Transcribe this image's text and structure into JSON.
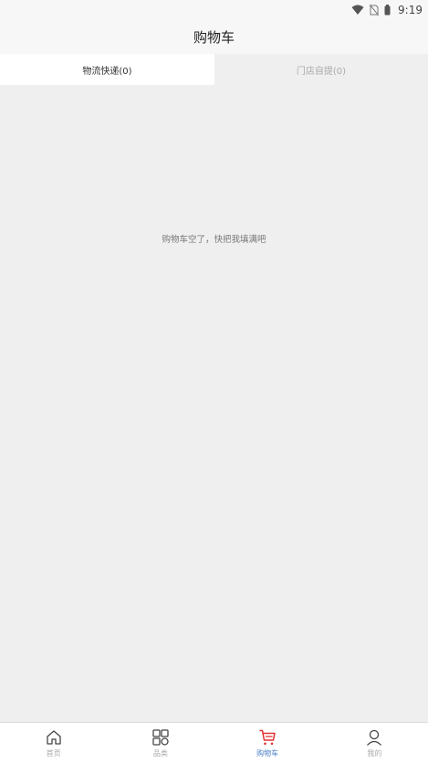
{
  "status_bar": {
    "time": "9:19",
    "icons": [
      "wifi-icon",
      "no-sim-icon",
      "battery-icon"
    ]
  },
  "header": {
    "title": "购物车"
  },
  "tabs": [
    {
      "label": "物流快递(0)",
      "active": true
    },
    {
      "label": "门店自提(0)",
      "active": false
    }
  ],
  "main": {
    "empty_message": "购物车空了，快把我填满吧"
  },
  "bottom_nav": {
    "items": [
      {
        "label": "首页",
        "icon": "home-icon",
        "active": false
      },
      {
        "label": "品类",
        "icon": "category-grid-icon",
        "active": false
      },
      {
        "label": "购物车",
        "icon": "cart-icon",
        "active": true
      },
      {
        "label": "我的",
        "icon": "user-icon",
        "active": false
      }
    ]
  },
  "colors": {
    "accent": "#e03131",
    "active_label": "#4a7fc8",
    "background": "#efefef"
  }
}
